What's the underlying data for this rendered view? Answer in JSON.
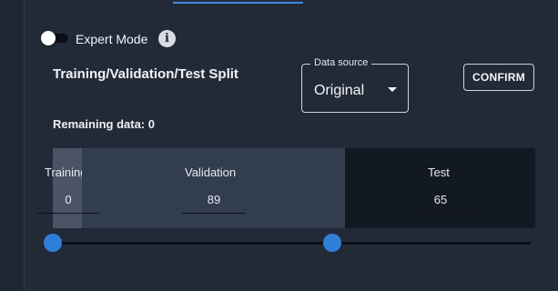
{
  "expert_mode": {
    "label": "Expert Mode",
    "enabled": false,
    "info_icon": "info-icon"
  },
  "split": {
    "title": "Training/Validation/Test Split",
    "remaining_text": "Remaining data: 0",
    "segments": [
      {
        "label": "Training",
        "value": "0"
      },
      {
        "label": "Validation",
        "value": "89"
      },
      {
        "label": "Test",
        "value": "65"
      }
    ]
  },
  "data_source": {
    "legend": "Data source",
    "value": "Original"
  },
  "confirm_label": "CONFIRM",
  "colors": {
    "accent": "#2f7fd9",
    "background": "#222a38"
  }
}
